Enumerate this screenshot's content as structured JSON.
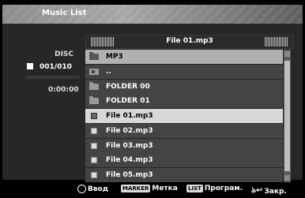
{
  "window": {
    "title": "Music List"
  },
  "left": {
    "disc_label": "DISC",
    "track_counter": "001/010",
    "time": "0:00:00"
  },
  "header": {
    "current_file": "File 01.mp3"
  },
  "list": {
    "items": [
      {
        "label": "MP3",
        "icon": "folder-icon",
        "type": "current-folder"
      },
      {
        "label": "..",
        "icon": "parent-folder-icon",
        "type": "up"
      },
      {
        "label": "FOLDER 00",
        "icon": "folder-icon",
        "type": "folder"
      },
      {
        "label": "FOLDER 01",
        "icon": "folder-icon",
        "type": "folder"
      },
      {
        "label": "File 01.mp3",
        "icon": "file-icon",
        "type": "file",
        "selected": true
      },
      {
        "label": "File 02.mp3",
        "icon": "file-icon",
        "type": "file"
      },
      {
        "label": "File 03.mp3",
        "icon": "file-icon",
        "type": "file"
      },
      {
        "label": "File 04.mp3",
        "icon": "file-icon",
        "type": "file"
      },
      {
        "label": "File 05.mp3",
        "icon": "file-icon",
        "type": "file"
      }
    ]
  },
  "footer": {
    "enter": {
      "icon": "enter-circle-icon",
      "label": "Ввод"
    },
    "marker": {
      "key": "MARKER",
      "label": "Метка"
    },
    "list": {
      "key": "LIST",
      "label": "Програм."
    },
    "close": {
      "icon": "close-return-icon",
      "glyph": "ঌ↩",
      "label": "Закр."
    }
  }
}
